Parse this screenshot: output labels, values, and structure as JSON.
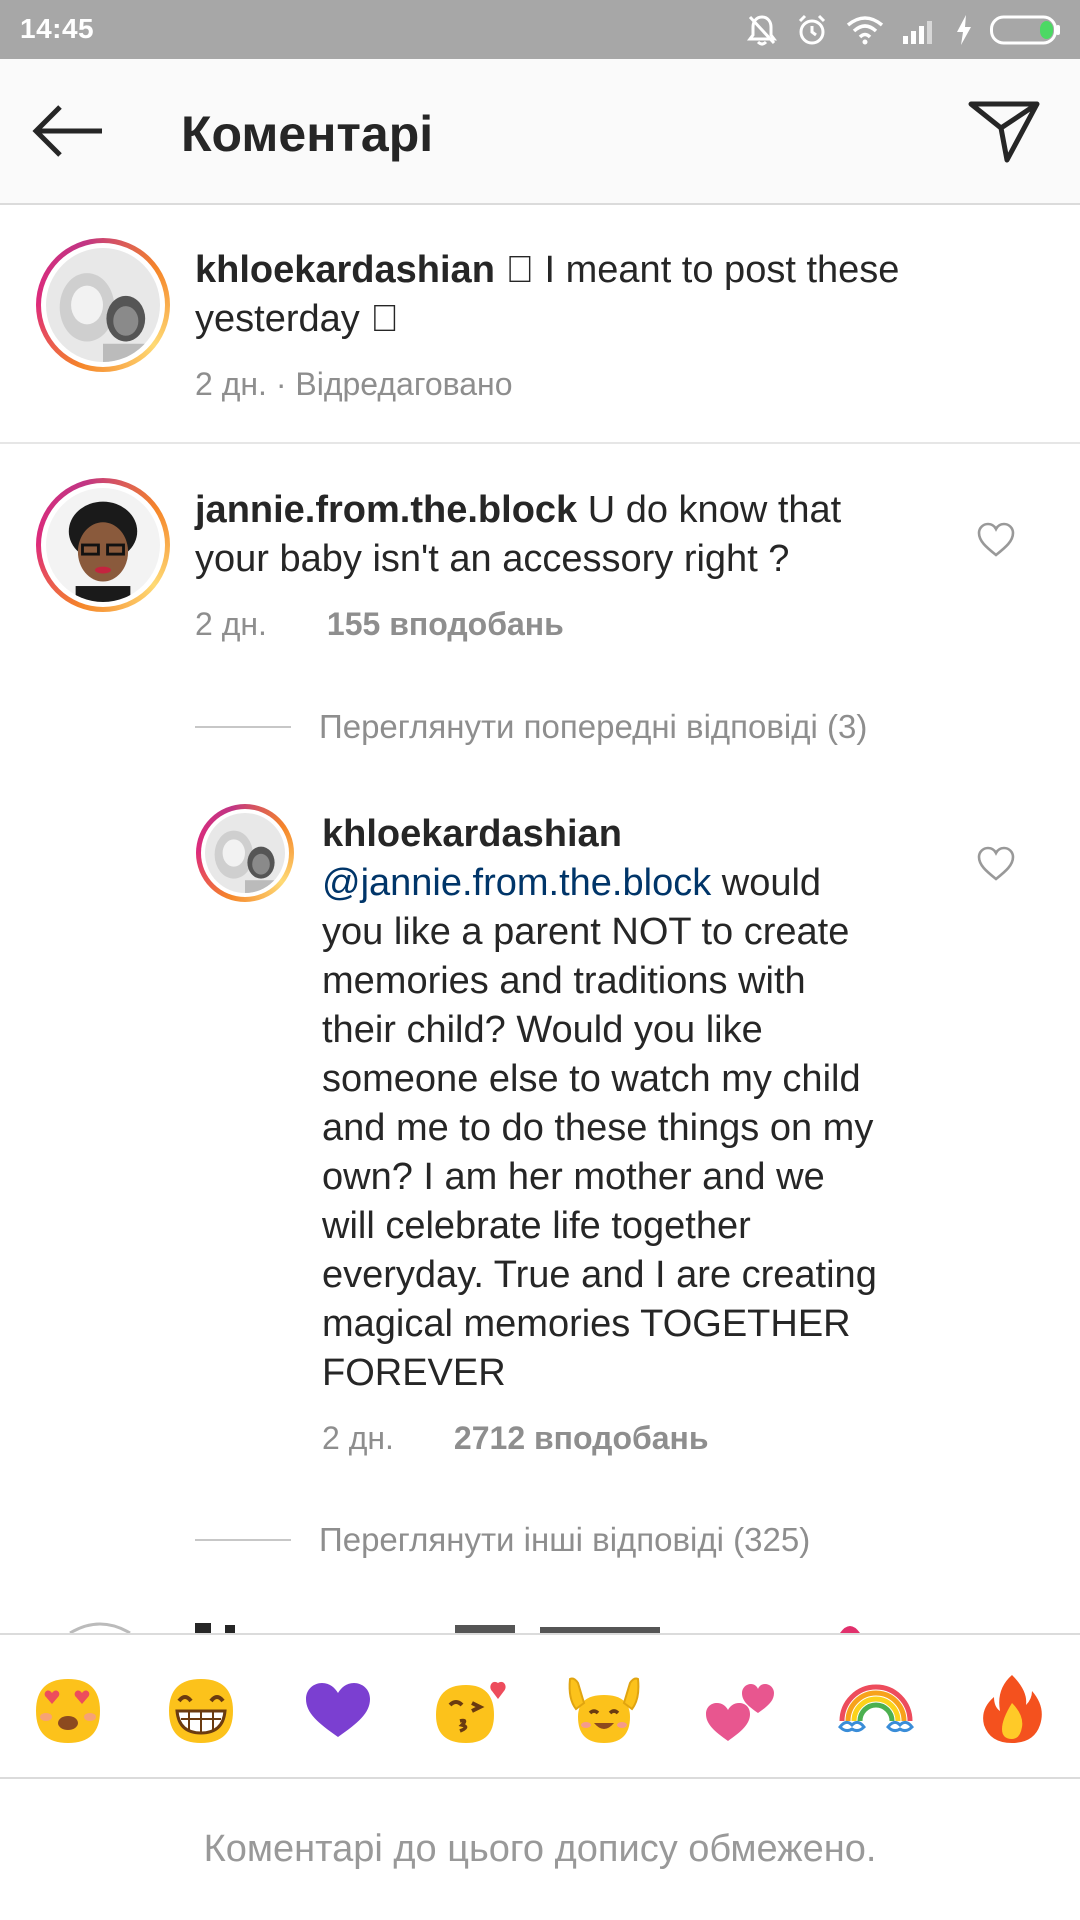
{
  "status_bar": {
    "time": "14:45"
  },
  "app_bar": {
    "title": "Коментарі"
  },
  "caption": {
    "username": "khloekardashian",
    "text_line1": " \u0000 I meant to post these",
    "text_line2": "yesterday \u0000",
    "meta": "2 дн. · Відредаговано"
  },
  "comment1": {
    "username": "jannie.from.the.block",
    "text_line1": " U do know that",
    "text_line2": "your baby isn't an accessory right ?",
    "time": "2 дн.",
    "likes": "155 вподобань"
  },
  "view_previous_replies": "Переглянути попередні відповіді (3)",
  "reply": {
    "username": "khloekardashian",
    "mention": "@jannie.from.the.block",
    "lines": [
      " would",
      "you like a parent NOT to create",
      "memories and traditions with",
      "their child? Would you like",
      "someone else to watch my child",
      "and me to do these things on my",
      "own? I am her mother and we",
      "will celebrate life together",
      "everyday. True and I are creating",
      "magical memories TOGETHER",
      "FOREVER"
    ],
    "time": "2 дн.",
    "likes": "2712 вподобань"
  },
  "view_more_replies": "Переглянути інші відповіді (325)",
  "emoji_bar": {
    "items": [
      "heart-eyes-emoji",
      "grinning-squint-emoji",
      "purple-heart-emoji",
      "kissing-emoji",
      "raised-hands-emoji",
      "two-hearts-emoji",
      "rainbow-emoji",
      "fire-emoji"
    ]
  },
  "footer": {
    "restricted_text": "Коментарі до цього допису обмежено."
  },
  "colors": {
    "accent_link": "#003569",
    "secondary_text": "#8e8e8e",
    "status_bar": "#a7a7a7"
  }
}
